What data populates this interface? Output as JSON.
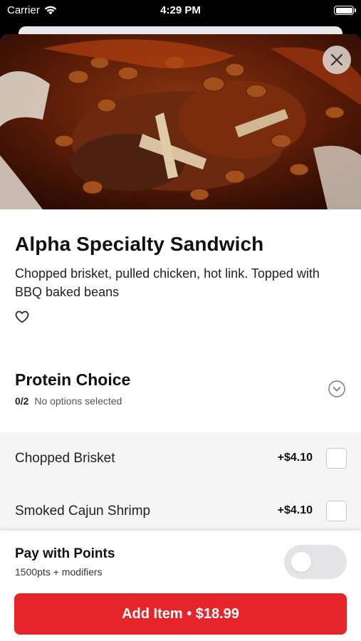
{
  "status_bar": {
    "carrier": "Carrier",
    "time": "4:29 PM",
    "wifi_icon": "wifi-icon",
    "battery_icon": "battery-icon"
  },
  "hero": {
    "image_icon": "food-photo"
  },
  "product": {
    "title": "Alpha Specialty Sandwich",
    "description": "Chopped brisket, pulled chicken, hot link. Topped with BBQ baked beans",
    "favorite_icon": "heart-outline-icon"
  },
  "modifier_group": {
    "title": "Protein Choice",
    "count": "0/2",
    "status": "No options selected",
    "expand_icon": "chevron-down-circle-icon",
    "options": [
      {
        "name": "Chopped Brisket",
        "price": "+$4.10",
        "selected": false
      },
      {
        "name": "Smoked Cajun Shrimp",
        "price": "+$4.10",
        "selected": false
      }
    ]
  },
  "pay_with_points": {
    "title": "Pay with Points",
    "subtitle": "1500pts + modifiers",
    "enabled": false
  },
  "add_button": {
    "label": "Add Item • $18.99"
  },
  "colors": {
    "accent": "#e5252a",
    "option_bg": "#f5f5f6",
    "toggle_off": "#e4e4e6"
  }
}
